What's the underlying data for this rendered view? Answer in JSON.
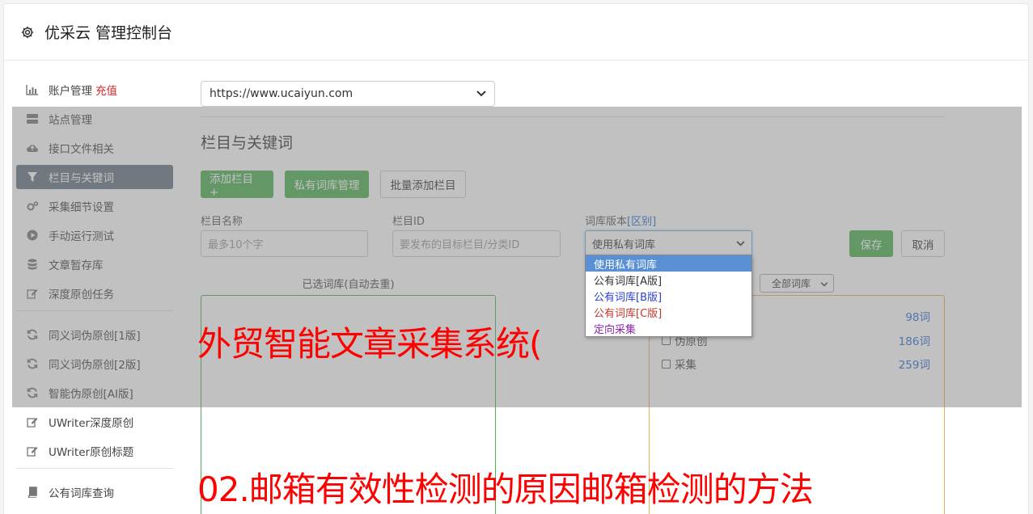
{
  "header": {
    "title": "优采云 管理控制台"
  },
  "sidebar": {
    "group1": [
      {
        "label": "账户管理",
        "badge": "充值",
        "icon": "bar-chart-icon"
      },
      {
        "label": "站点管理",
        "icon": "server-icon"
      },
      {
        "label": "接口文件相关",
        "icon": "cloud-upload-icon"
      },
      {
        "label": "栏目与关键词",
        "icon": "filter-icon",
        "active": true
      },
      {
        "label": "采集细节设置",
        "icon": "gears-icon"
      },
      {
        "label": "手动运行测试",
        "icon": "play-circle-icon"
      },
      {
        "label": "文章暂存库",
        "icon": "database-icon"
      },
      {
        "label": "深度原创任务",
        "icon": "edit-icon"
      }
    ],
    "group2": [
      {
        "label": "同义词伪原创[1版]",
        "icon": "refresh-icon"
      },
      {
        "label": "同义词伪原创[2版]",
        "icon": "refresh-icon"
      },
      {
        "label": "智能伪原创[AI版]",
        "icon": "refresh-icon"
      },
      {
        "label": "UWriter深度原创",
        "icon": "edit-icon"
      },
      {
        "label": "UWriter原创标题",
        "icon": "edit-icon"
      }
    ],
    "group3": [
      {
        "label": "公有词库查询",
        "icon": "book-icon"
      }
    ]
  },
  "main": {
    "site_select": {
      "value": "https://www.ucaiyun.com"
    },
    "section_title": "栏目与关键词",
    "buttons": {
      "add_column": "添加栏目 +",
      "private_lib": "私有词库管理",
      "batch_add": "批量添加栏目"
    },
    "form": {
      "column_name": {
        "label": "栏目名称",
        "placeholder": "最多10个字"
      },
      "column_id": {
        "label": "栏目ID",
        "placeholder": "要发布的目标栏目/分类ID"
      },
      "lib_version": {
        "label": "词库版本",
        "label_link": "[区别]",
        "value": "使用私有词库"
      },
      "save": "保存",
      "cancel": "取消"
    },
    "dropdown_options": [
      {
        "label": "使用私有词库",
        "color": "#ffffff",
        "selected": true
      },
      {
        "label": "公有词库[A版]",
        "color": "#333333"
      },
      {
        "label": "公有词库[B版]",
        "color": "#2a3fd1"
      },
      {
        "label": "公有词库[C版]",
        "color": "#c0392b"
      },
      {
        "label": "定向采集",
        "color": "#8e24aa"
      }
    ],
    "selected_caption": "已选词库(自动去重)",
    "lib_filter": "全部词库",
    "libraries": [
      {
        "name": "",
        "count": "98词"
      },
      {
        "name": "伪原创",
        "count": "186词"
      },
      {
        "name": "采集",
        "count": "259词"
      }
    ]
  },
  "banners": {
    "line1": "外贸智能文章采集系统(",
    "line2": "02.邮箱有效性检测的原因邮箱检测的方法"
  },
  "colors": {
    "accent_green": "#4caf50",
    "active_nav": "#687382",
    "overlay_red": "#ff0000"
  }
}
